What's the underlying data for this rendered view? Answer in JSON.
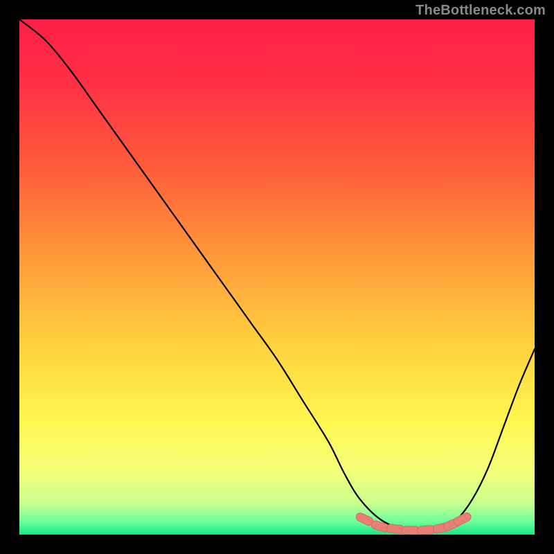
{
  "watermark": "TheBottleneck.com",
  "colors": {
    "frame": "#000000",
    "gradient_stops": [
      {
        "offset": 0.0,
        "color": "#ff1f47"
      },
      {
        "offset": 0.12,
        "color": "#ff2f46"
      },
      {
        "offset": 0.28,
        "color": "#ff5a3a"
      },
      {
        "offset": 0.45,
        "color": "#ff963a"
      },
      {
        "offset": 0.62,
        "color": "#ffce3c"
      },
      {
        "offset": 0.78,
        "color": "#fff650"
      },
      {
        "offset": 0.88,
        "color": "#f4ff7a"
      },
      {
        "offset": 0.94,
        "color": "#c6ff8e"
      },
      {
        "offset": 0.975,
        "color": "#6cff9a"
      },
      {
        "offset": 1.0,
        "color": "#17e884"
      }
    ],
    "curve": "#000000",
    "marker_fill": "#e77f77",
    "marker_stroke": "#d96b63"
  },
  "chart_data": {
    "type": "line",
    "title": "",
    "xlabel": "",
    "ylabel": "",
    "xlim": [
      0,
      100
    ],
    "ylim": [
      0,
      100
    ],
    "series": [
      {
        "name": "bottleneck-curve",
        "x": [
          0,
          5,
          10,
          15,
          20,
          25,
          30,
          35,
          40,
          45,
          50,
          55,
          60,
          63,
          66,
          70,
          74,
          78,
          82,
          85,
          88,
          91,
          94,
          97,
          100
        ],
        "y": [
          100,
          96,
          90,
          83,
          76,
          69,
          62,
          55,
          48,
          41,
          34,
          26,
          18,
          12,
          7,
          3,
          1.2,
          0.7,
          1.0,
          3,
          7,
          13,
          21,
          29,
          36
        ]
      }
    ],
    "markers": {
      "name": "optimal-range-highlight",
      "x": [
        67,
        70,
        73,
        76,
        79,
        82,
        84,
        86
      ],
      "y": [
        3.0,
        1.6,
        1.1,
        0.8,
        0.9,
        1.3,
        2.0,
        3.0
      ]
    }
  }
}
